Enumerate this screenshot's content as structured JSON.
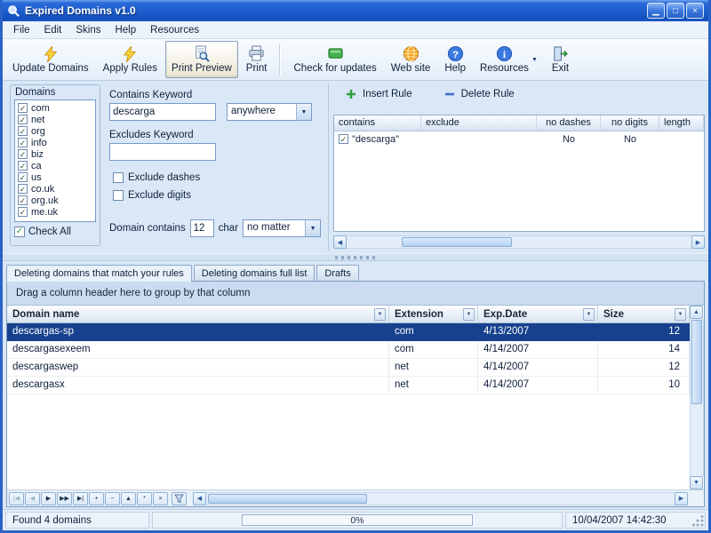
{
  "window": {
    "title": "Expired Domains v1.0",
    "controls": {
      "minimize": "▁",
      "maximize": "□",
      "close": "×"
    }
  },
  "menubar": {
    "items": [
      "File",
      "Edit",
      "Skins",
      "Help",
      "Resources"
    ]
  },
  "toolbar": {
    "buttons": [
      {
        "label": "Update Domains",
        "icon": "lightning-icon"
      },
      {
        "label": "Apply Rules",
        "icon": "lightning-icon"
      },
      {
        "label": "Print Preview",
        "icon": "print-preview-icon"
      },
      {
        "label": "Print",
        "icon": "printer-icon"
      },
      {
        "label": "Check for updates",
        "icon": "update-box-icon"
      },
      {
        "label": "Web site",
        "icon": "globe-icon"
      },
      {
        "label": "Help",
        "icon": "help-icon"
      },
      {
        "label": "Resources",
        "icon": "info-icon"
      },
      {
        "label": "Exit",
        "icon": "exit-icon"
      }
    ]
  },
  "domains_panel": {
    "title": "Domains",
    "check_all_label": "Check All",
    "items": [
      "com",
      "net",
      "org",
      "info",
      "biz",
      "ca",
      "us",
      "co.uk",
      "org.uk",
      "me.uk"
    ]
  },
  "filters": {
    "contains_keyword_label": "Contains Keyword",
    "contains_keyword_value": "descarga",
    "position_value": "anywhere",
    "excludes_keyword_label": "Excludes Keyword",
    "excludes_keyword_value": "",
    "exclude_dashes_label": "Exclude dashes",
    "exclude_digits_label": "Exclude digits",
    "domain_contains_label": "Domain contains",
    "domain_contains_value": "12",
    "char_label": "char",
    "length_mode_value": "no matter"
  },
  "rules": {
    "insert_button_label": "Insert Rule",
    "delete_button_label": "Delete Rule",
    "columns": [
      "contains",
      "exclude",
      "no dashes",
      "no digits",
      "length"
    ],
    "rows": [
      {
        "contains": "\"descarga\"",
        "exclude": "",
        "no_dashes": "No",
        "no_digits": "No",
        "length": ""
      }
    ]
  },
  "tabs": [
    "Deleting domains that match your rules",
    "Deleting domains full list",
    "Drafts"
  ],
  "grid": {
    "group_hint": "Drag a column header here to group by that column",
    "columns": [
      "Domain name",
      "Extension",
      "Exp.Date",
      "Size"
    ],
    "rows": [
      {
        "name": "descargas-sp",
        "ext": "com",
        "date": "4/13/2007",
        "size": "12"
      },
      {
        "name": "descargasexeem",
        "ext": "com",
        "date": "4/14/2007",
        "size": "14"
      },
      {
        "name": "descargaswep",
        "ext": "net",
        "date": "4/14/2007",
        "size": "12"
      },
      {
        "name": "descargasx",
        "ext": "net",
        "date": "4/14/2007",
        "size": "10"
      }
    ]
  },
  "navigator": {
    "buttons": [
      {
        "name": "first",
        "glyph": "|◀"
      },
      {
        "name": "prev",
        "glyph": "◀"
      },
      {
        "name": "next",
        "glyph": "▶"
      },
      {
        "name": "next-page",
        "glyph": "▶▶"
      },
      {
        "name": "last",
        "glyph": "▶|"
      },
      {
        "name": "append",
        "glyph": "+"
      },
      {
        "name": "delete",
        "glyph": "−"
      },
      {
        "name": "edit",
        "glyph": "▲"
      },
      {
        "name": "post",
        "glyph": "*"
      },
      {
        "name": "cancel",
        "glyph": "×"
      }
    ]
  },
  "statusbar": {
    "found_text": "Found 4 domains",
    "progress_text": "0%",
    "datetime": "10/04/2007 14:42:30"
  },
  "colors": {
    "titlebar_blue": "#1e5ecf",
    "selection_blue": "#17418e",
    "panel_blue": "#d9e7f6",
    "accent_border": "#7a9ac4"
  }
}
